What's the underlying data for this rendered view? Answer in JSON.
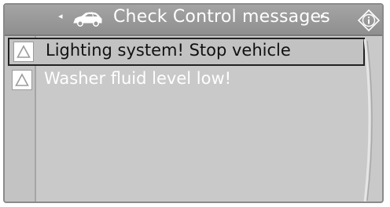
{
  "header": {
    "title": "Check Control messages",
    "left_arrow": "◂",
    "right_arrow": "▸",
    "car_icon": "car-icon",
    "info_icon": "info-icon"
  },
  "messages": [
    {
      "text": "Lighting system! Stop vehicle",
      "icon": "warning-triangle-icon",
      "selected": true
    },
    {
      "text": "Washer fluid level low!",
      "icon": "warning-triangle-icon",
      "selected": false
    }
  ],
  "colors": {
    "header": "#9a9a9a",
    "background": "#c9c9c9",
    "selected_border": "#222222",
    "text_light": "#ffffff"
  }
}
